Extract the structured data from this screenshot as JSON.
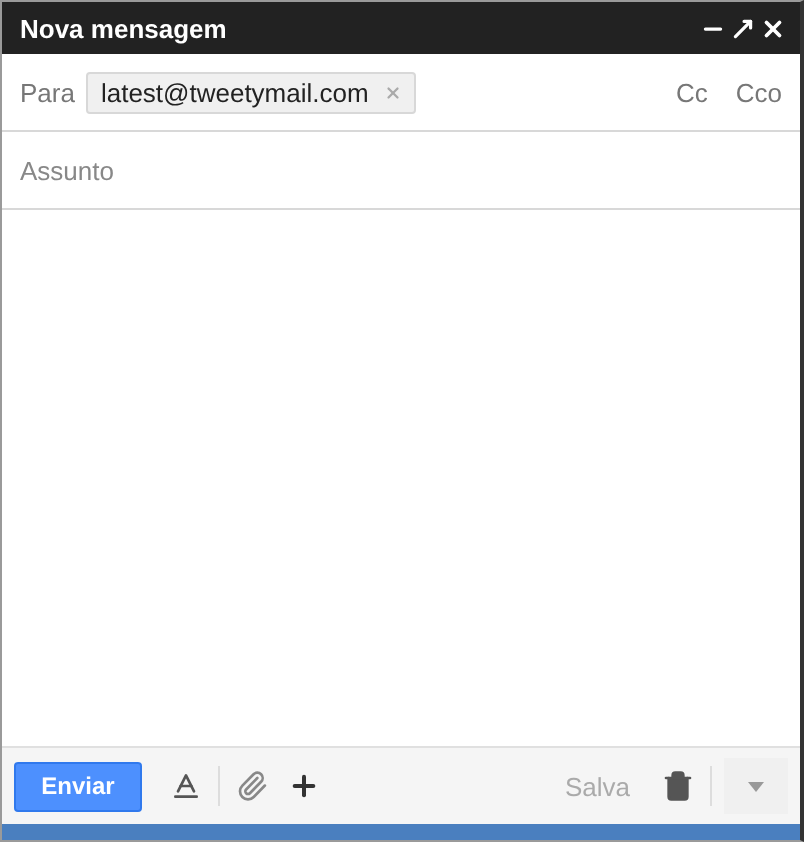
{
  "window": {
    "title": "Nova mensagem"
  },
  "to": {
    "label": "Para",
    "recipients": [
      {
        "address": "latest@tweetymail.com"
      }
    ],
    "cc": "Cc",
    "bcc": "Cco"
  },
  "subject": {
    "placeholder": "Assunto"
  },
  "footer": {
    "send": "Enviar",
    "saved": "Salva"
  }
}
